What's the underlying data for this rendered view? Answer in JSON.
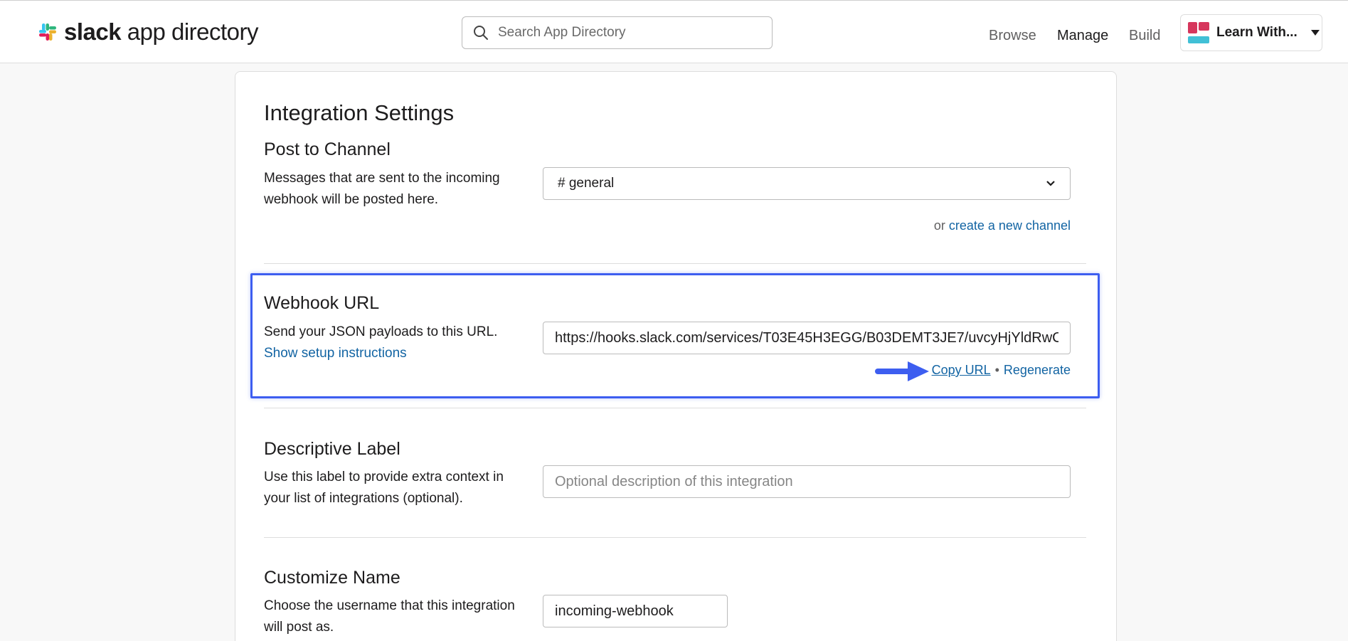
{
  "header": {
    "logo_bold": "slack",
    "logo_rest": " app directory",
    "search_placeholder": "Search App Directory",
    "nav": {
      "browse": "Browse",
      "manage": "Manage",
      "build": "Build"
    },
    "workspace_name": "Learn With..."
  },
  "main": {
    "page_title": "Integration Settings",
    "post_to_channel": {
      "title": "Post to Channel",
      "desc": "Messages that are sent to the incoming webhook will be posted here.",
      "selected_channel": "# general",
      "or_text": "or",
      "create_link": "create a new channel"
    },
    "webhook": {
      "title": "Webhook URL",
      "desc": "Send your JSON payloads to this URL.",
      "setup_link": "Show setup instructions",
      "url_value": "https://hooks.slack.com/services/T03E45H3EGG/B03DEMT3JE7/uvcyHjYldRwC",
      "copy_label": "Copy URL",
      "separator": "•",
      "regenerate_label": "Regenerate"
    },
    "descriptive_label": {
      "title": "Descriptive Label",
      "desc": "Use this label to provide extra context in your list of integrations (optional).",
      "placeholder": "Optional description of this integration"
    },
    "customize_name": {
      "title": "Customize Name",
      "desc": "Choose the username that this integration will post as.",
      "value": "incoming-webhook"
    }
  },
  "colors": {
    "link": "#1264a3",
    "highlight": "#3d5ef0",
    "arrow": "#3d5ef0"
  },
  "icons": [
    "slack-logo-icon",
    "search-icon",
    "workspace-avatar-icon",
    "caret-down-icon",
    "chevron-down-icon",
    "arrow-right-icon"
  ]
}
